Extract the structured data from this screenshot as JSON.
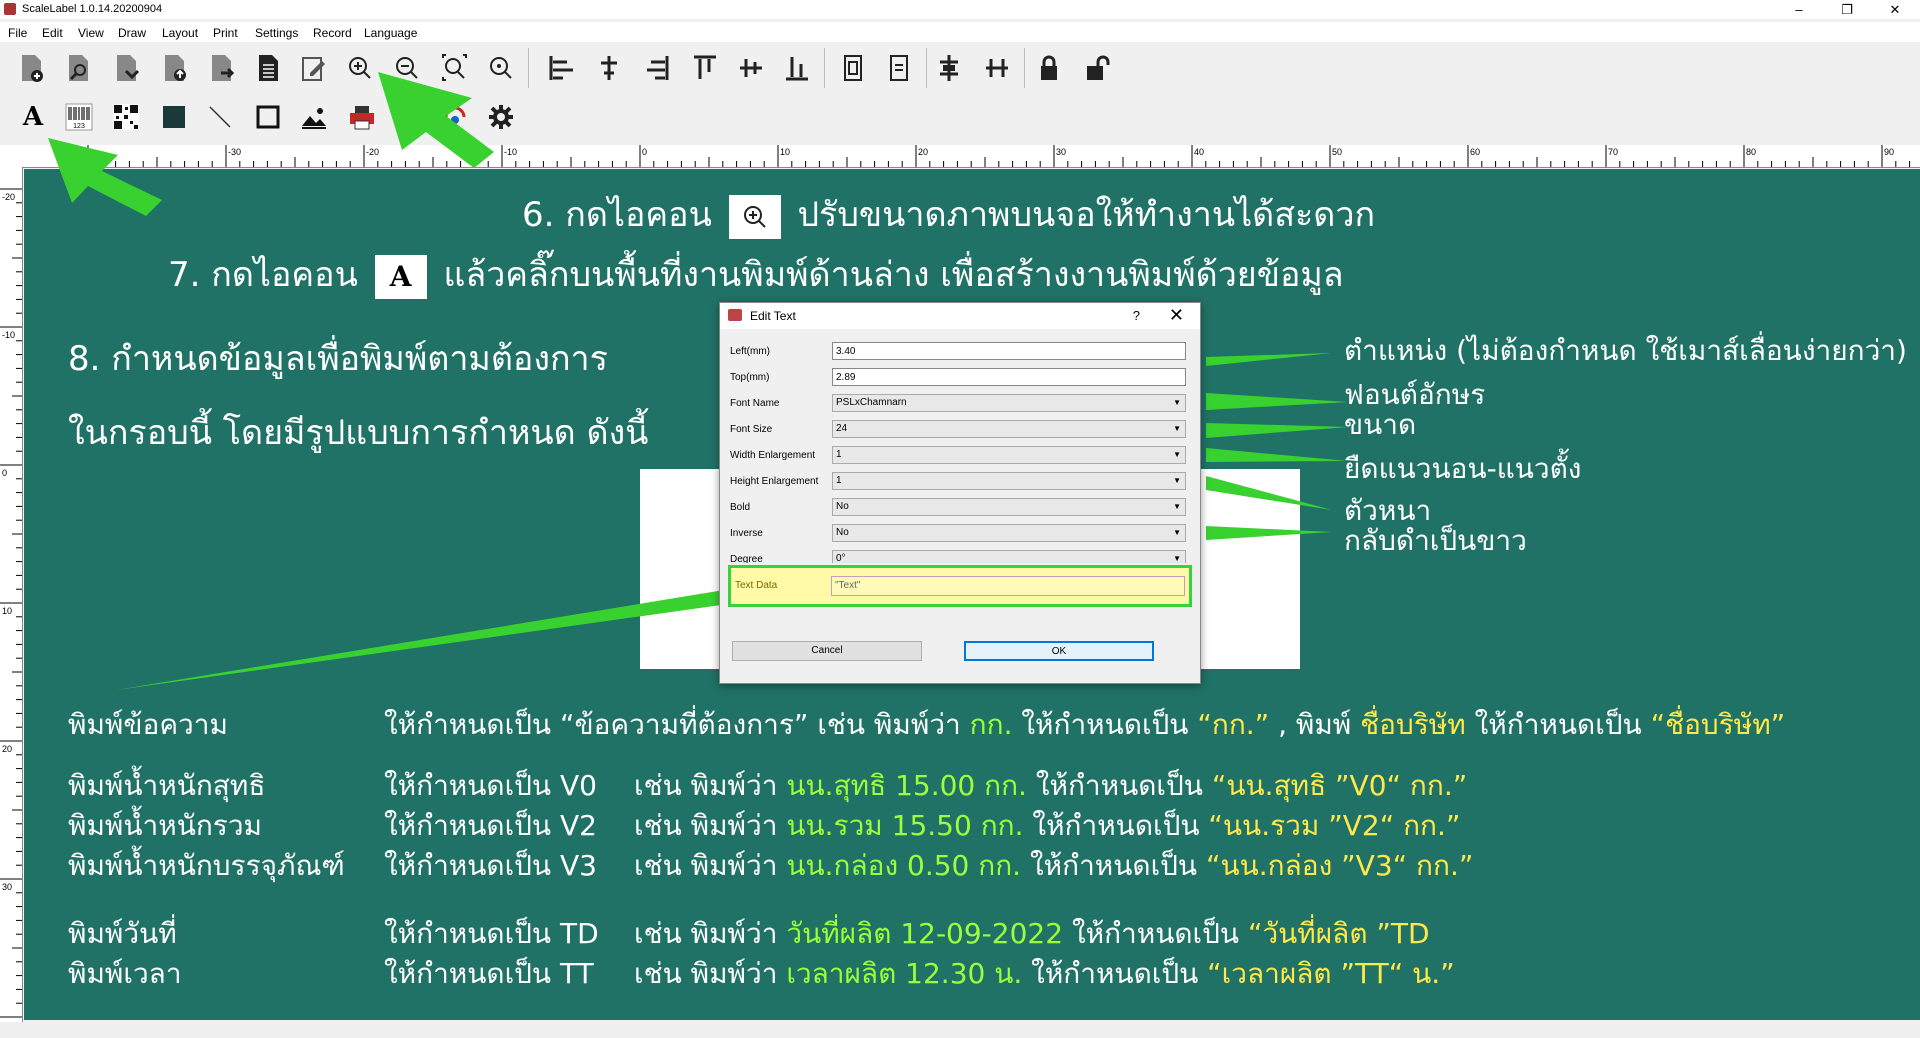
{
  "window": {
    "title": "ScaleLabel 1.0.14.20200904",
    "minimize": "–",
    "maximize": "❐",
    "close": "✕"
  },
  "menu": [
    "File",
    "Edit",
    "View",
    "Draw",
    "Layout",
    "Print",
    "Settings",
    "Record",
    "Language"
  ],
  "ruler": {
    "h_labels": [
      "-30",
      "-20",
      "-10",
      "0",
      "10",
      "20",
      "30",
      "40",
      "50",
      "60",
      "70",
      "80",
      "90"
    ],
    "v_labels": [
      "-20",
      "-10",
      "0",
      "10",
      "20",
      "30"
    ]
  },
  "toolbar2": {
    "text_tool": "A",
    "barcode_caption": "123"
  },
  "instructions": {
    "step6_prefix": "6. กดไอคอน",
    "step6_suffix": "ปรับขนาดภาพบนจอให้ทำงานได้สะดวก",
    "step7_prefix": "7. กดไอคอน",
    "step7_icon": "A",
    "step7_suffix": "แล้วคลิ๊กบนพื้นที่งานพิมพ์ด้านล่าง เพื่อสร้างงานพิมพ์ด้วยข้อมูล",
    "step8_line1": "8. กำหนดข้อมูลเพื่อพิมพ์ตามต้องการ",
    "step8_line2": "ในกรอบนี้ โดยมีรูปแบบการกำหนด ดังนี้"
  },
  "annotations": {
    "position": "ตำแหน่ง (ไม่ต้องกำหนด ใช้เมาส์เลื่อนง่ายกว่า)",
    "font": "ฟอนต์อักษร",
    "size": "ขนาด",
    "stretch": "ยืดแนวนอน-แนวตั้ง",
    "bold": "ตัวหนา",
    "inverse": "กลับดำเป็นขาว"
  },
  "dialog": {
    "title": "Edit Text",
    "help": "?",
    "close": "✕",
    "fields": {
      "left_label": "Left(mm)",
      "left_value": "3.40",
      "top_label": "Top(mm)",
      "top_value": "2.89",
      "font_label": "Font Name",
      "font_value": "PSLxChamnarn",
      "size_label": "Font Size",
      "size_value": "24",
      "width_label": "Width Enlargement",
      "width_value": "1",
      "height_label": "Height Enlargement",
      "height_value": "1",
      "bold_label": "Bold",
      "bold_value": "No",
      "inverse_label": "Inverse",
      "inverse_value": "No",
      "degree_label": "Degree",
      "degree_value": "0°",
      "textdata_label": "Text Data",
      "textdata_value": "\"Text\""
    },
    "cancel": "Cancel",
    "ok": "OK"
  },
  "rules": [
    {
      "name": "พิมพ์ข้อความ",
      "set": "ให้กำหนดเป็น “ข้อความที่ต้องการ” เช่น พิมพ์ว่า",
      "ex": "กก.",
      "set2": "ให้กำหนดเป็น",
      "ans": "“กก.”",
      "more": ", พิมพ์",
      "ex2": "ชื่อบริษัท",
      "set3": "ให้กำหนดเป็น",
      "ans2": "“ชื่อบริษัท”"
    },
    {
      "name": "พิมพ์น้ำหนักสุทธิ",
      "set": "ให้กำหนดเป็น V0",
      "eg": "เช่น พิมพ์ว่า",
      "ex": "นน.สุทธิ 15.00 กก.",
      "set2": "ให้กำหนดเป็น",
      "ans": "“นน.สุทธิ ”V0“ กก.”"
    },
    {
      "name": "พิมพ์น้ำหนักรวม",
      "set": "ให้กำหนดเป็น V2",
      "eg": "เช่น พิมพ์ว่า",
      "ex": "นน.รวม 15.50 กก.",
      "set2": "ให้กำหนดเป็น",
      "ans": "“นน.รวม ”V2“ กก.”"
    },
    {
      "name": "พิมพ์น้ำหนักบรรจุภัณฑ์",
      "set": "ให้กำหนดเป็น V3",
      "eg": "เช่น พิมพ์ว่า",
      "ex": "นน.กล่อง 0.50 กก.",
      "set2": "ให้กำหนดเป็น",
      "ans": "“นน.กล่อง ”V3“ กก.”"
    },
    {
      "name": "พิมพ์วันที่",
      "set": "ให้กำหนดเป็น TD",
      "eg": "เช่น พิมพ์ว่า",
      "ex": "วันที่ผลิต 12-09-2022",
      "set2": "ให้กำหนดเป็น",
      "ans": "“วันที่ผลิต ”TD"
    },
    {
      "name": "พิมพ์เวลา",
      "set": "ให้กำหนดเป็น TT",
      "eg": "เช่น พิมพ์ว่า",
      "ex": "เวลาผลิต 12.30 น.",
      "set2": "ให้กำหนดเป็น",
      "ans": "“เวลาผลิต ”TT“ น.”"
    }
  ],
  "colors": {
    "canvas": "#1f7265",
    "highlight_green": "#3ad13a",
    "yellow_text": "#ffe94a",
    "green_text": "#9cff3a"
  }
}
